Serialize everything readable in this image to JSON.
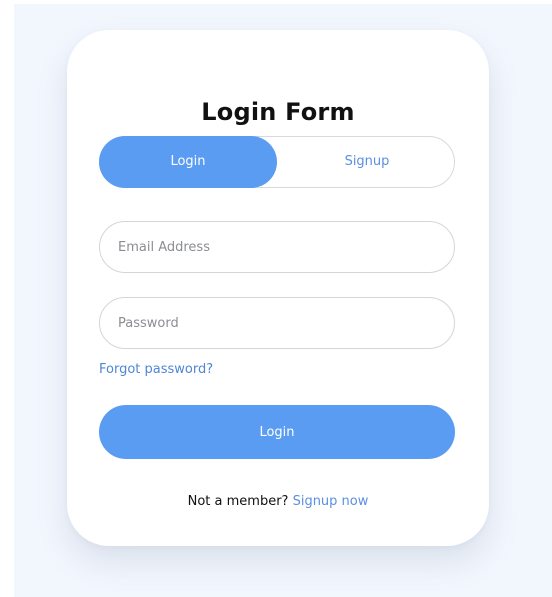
{
  "form": {
    "title": "Login Form",
    "tabs": {
      "login": "Login",
      "signup": "Signup"
    },
    "email_placeholder": "Email Address",
    "password_placeholder": "Password",
    "forgot_password": "Forgot password?",
    "submit_label": "Login",
    "footer": {
      "prompt": "Not a member?",
      "link": "Signup now"
    }
  },
  "colors": {
    "accent": "#5b9cf3",
    "link": "#4f86d6",
    "page_background": "#f2f6fd",
    "card": "#ffffff"
  }
}
